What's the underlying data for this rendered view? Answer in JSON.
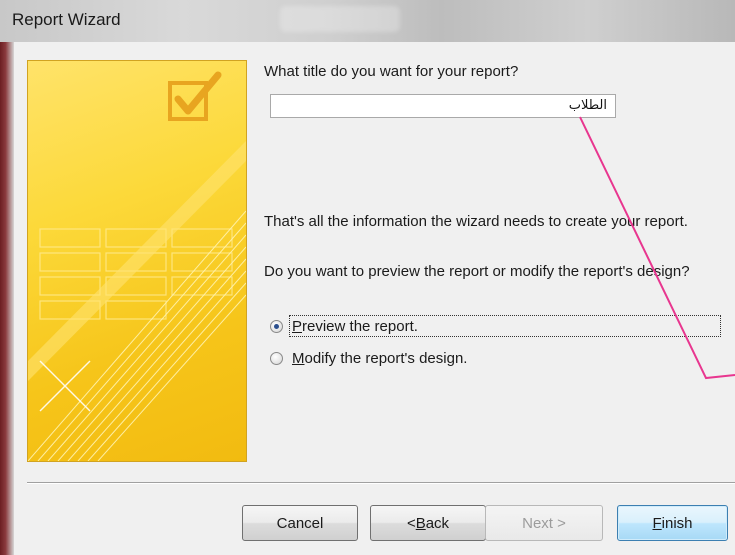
{
  "window": {
    "title": "Report Wizard"
  },
  "form": {
    "question": "What title do you want for your report?",
    "report_title_value": "الطلاب",
    "info_text": "That's all the information the wizard needs to create your report.",
    "preview_question": "Do you want to preview the report or modify the report's design?",
    "options": [
      {
        "accel": "P",
        "rest": "review the report.",
        "checked": true
      },
      {
        "accel": "M",
        "rest": "odify the report's design.",
        "checked": false
      }
    ]
  },
  "buttons": {
    "cancel": "Cancel",
    "back_prefix": "< ",
    "back_accel": "B",
    "back_rest": "ack",
    "next": "Next >",
    "finish_accel": "F",
    "finish_rest": "inish"
  },
  "colors": {
    "annotation_line": "#e8368f",
    "wizard_art": "#fcd93a",
    "radio_dot": "#2b4f8e"
  }
}
